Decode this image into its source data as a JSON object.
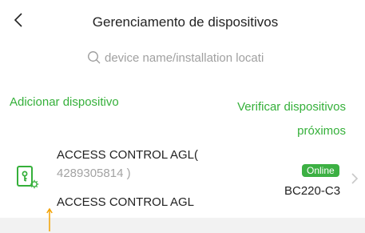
{
  "header": {
    "title": "Gerenciamento de dispositivos"
  },
  "search": {
    "placeholder": "device name/installation locati"
  },
  "actions": {
    "add_device": "Adicionar dispositivo",
    "verify_nearby_line1": "Verificar dispositivos",
    "verify_nearby_line2": "próximos"
  },
  "device": {
    "name_line1": "ACCESS CONTROL AGL(",
    "name_line2": "4289305814 )",
    "name_line3": "ACCESS CONTROL AGL",
    "status": "Online",
    "model": "BC220-C3",
    "icon": "access-control-device-icon"
  },
  "colors": {
    "accent": "#35b03a",
    "badge": "#3cb043",
    "secondary_text": "#a3a3a3",
    "bottom_band": "#f2f2f2"
  }
}
